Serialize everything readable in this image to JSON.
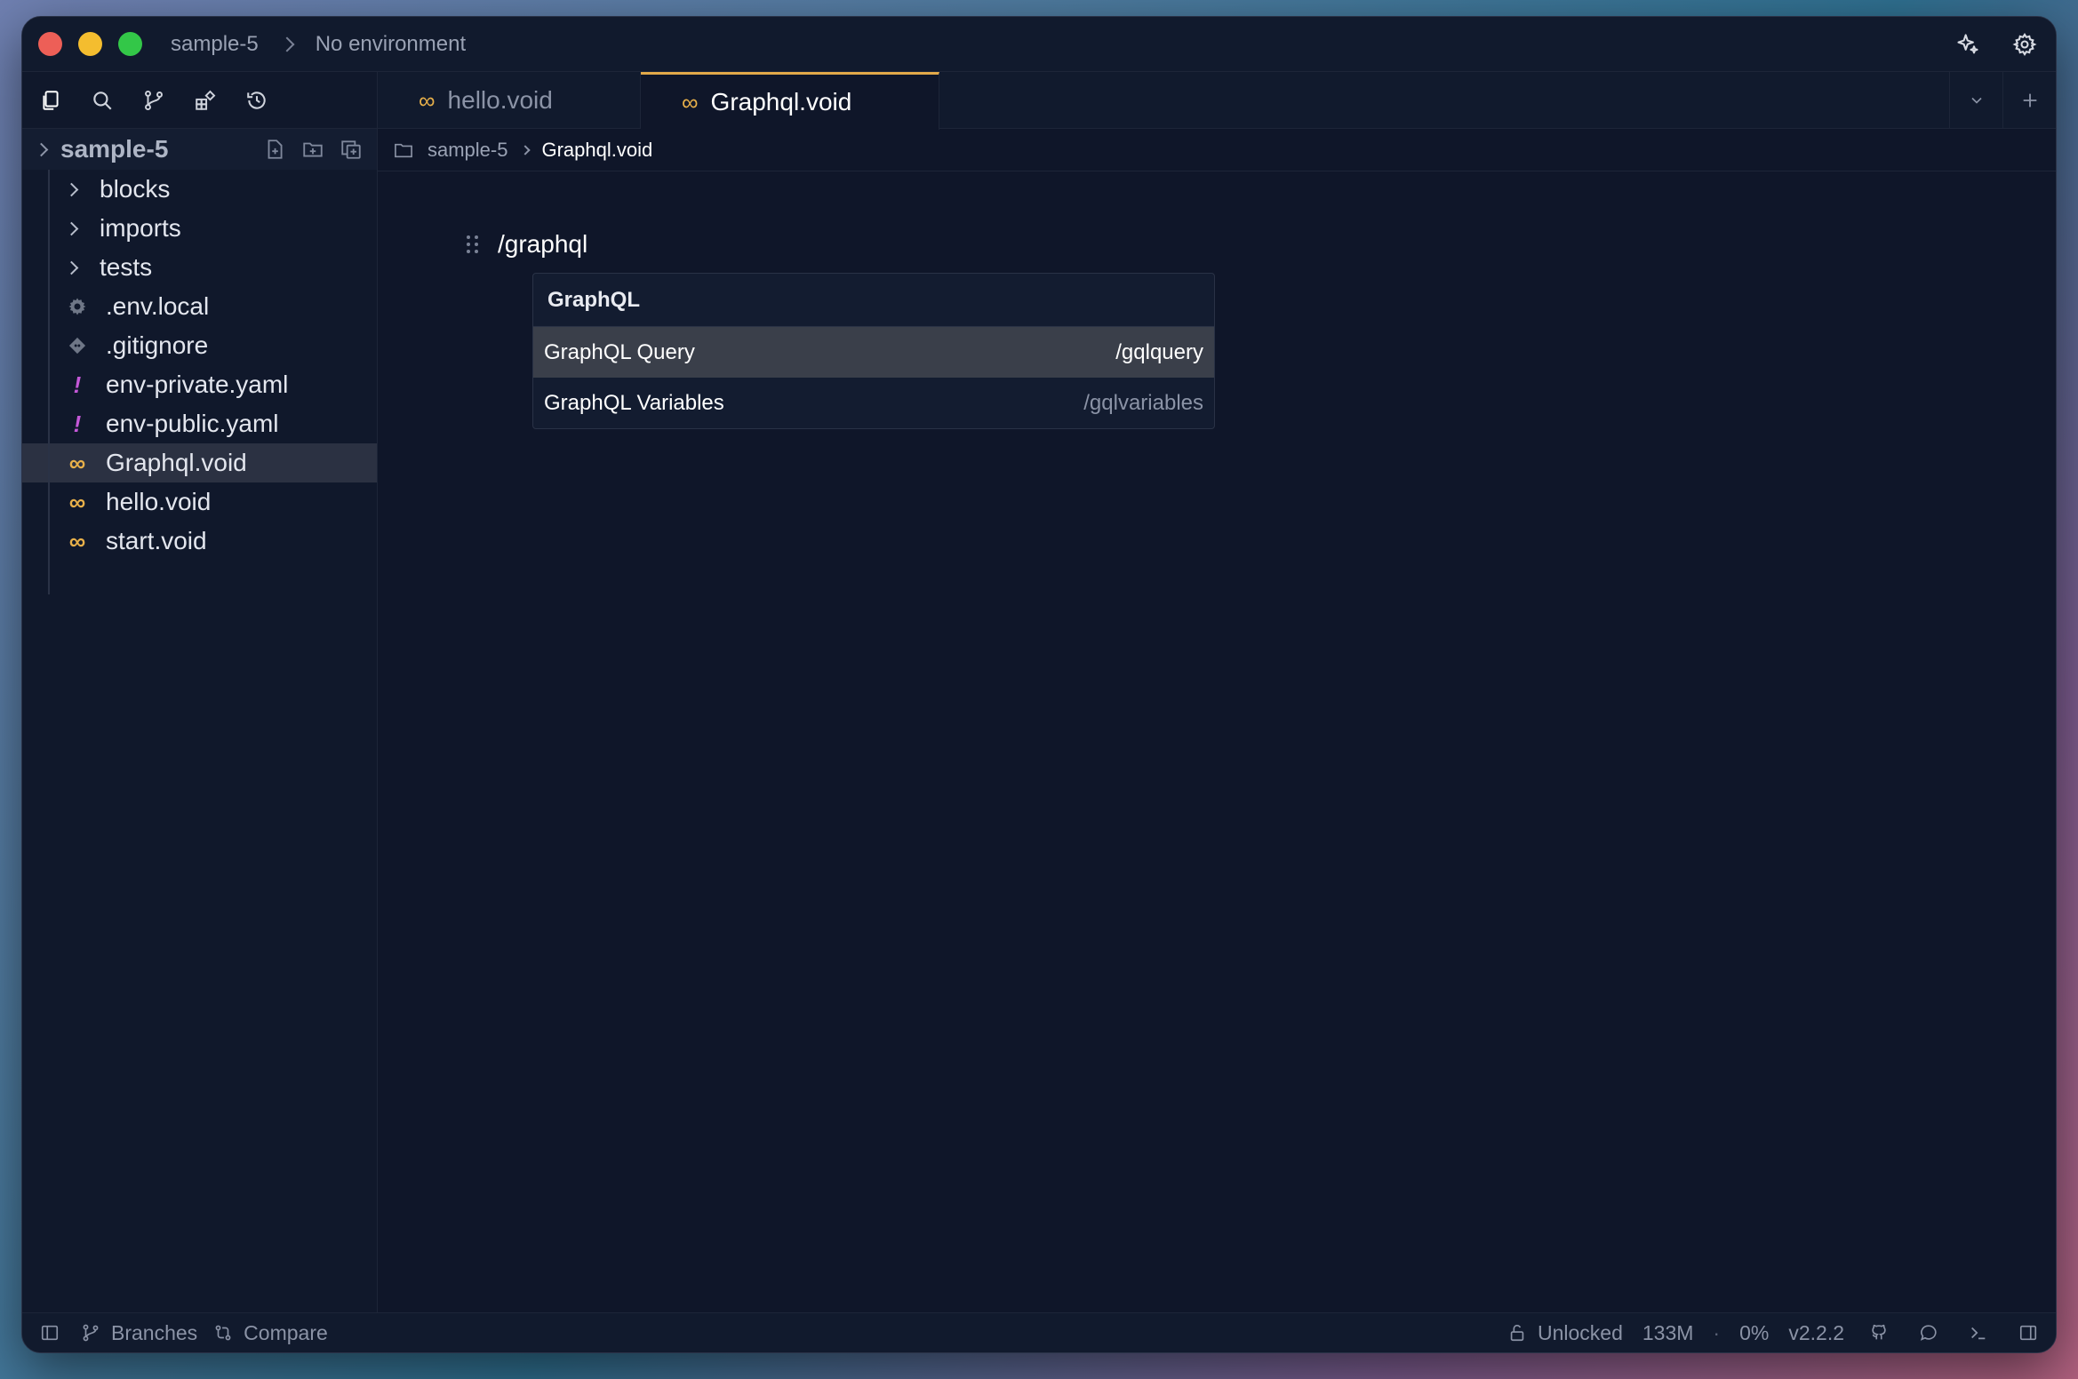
{
  "titlebar": {
    "project": "sample-5",
    "environment": "No environment",
    "icons": [
      "sparkle-icon",
      "gear-icon"
    ]
  },
  "sidebar": {
    "toolbar_icons": [
      "files-icon",
      "search-icon",
      "branch-icon",
      "extensions-icon",
      "history-icon"
    ],
    "project_name": "sample-5",
    "project_actions": [
      "new-file-icon",
      "new-folder-icon",
      "copy-icon"
    ],
    "items": [
      {
        "label": "blocks",
        "type": "folder"
      },
      {
        "label": "imports",
        "type": "folder"
      },
      {
        "label": "tests",
        "type": "folder"
      },
      {
        "label": ".env.local",
        "type": "gear"
      },
      {
        "label": ".gitignore",
        "type": "git"
      },
      {
        "label": "env-private.yaml",
        "type": "yaml"
      },
      {
        "label": "env-public.yaml",
        "type": "yaml"
      },
      {
        "label": "Graphql.void",
        "type": "void",
        "selected": true
      },
      {
        "label": "hello.void",
        "type": "void"
      },
      {
        "label": "start.void",
        "type": "void"
      }
    ]
  },
  "tabs": [
    {
      "label": "hello.void",
      "active": false
    },
    {
      "label": "Graphql.void",
      "active": true
    }
  ],
  "breadcrumb": {
    "folder": "sample-5",
    "current": "Graphql.void"
  },
  "editor": {
    "slash_text": "/graphql",
    "menu": {
      "header": "GraphQL",
      "items": [
        {
          "label": "GraphQL Query",
          "shortcut": "/gqlquery",
          "highlighted": true
        },
        {
          "label": "GraphQL Variables",
          "shortcut": "/gqlvariables",
          "highlighted": false
        }
      ]
    }
  },
  "statusbar": {
    "branches": "Branches",
    "compare": "Compare",
    "lock": "Unlocked",
    "memory": "133M",
    "dot": "·",
    "cpu": "0%",
    "version": "v2.2.2"
  },
  "colors": {
    "accent": "#e2a94a",
    "void_icon": "#e8b04a",
    "yaml_icon": "#c558d8",
    "background": "#0f1629"
  }
}
